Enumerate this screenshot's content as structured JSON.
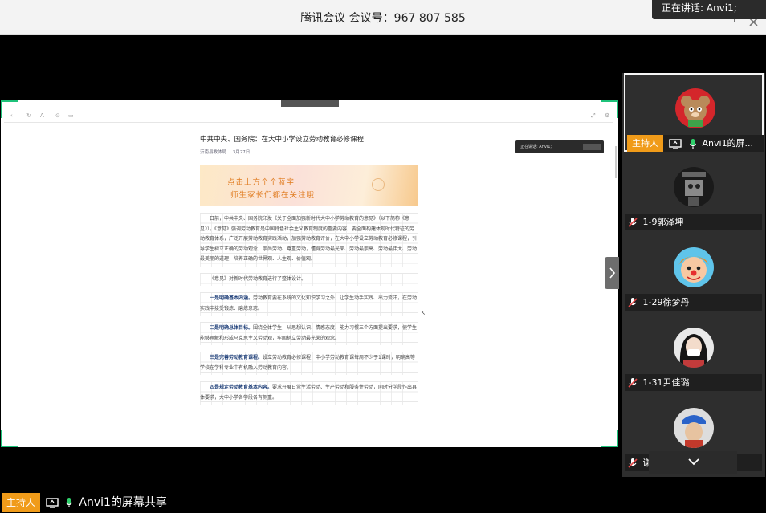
{
  "window": {
    "title": "腾讯会议 会议号：967 807 585"
  },
  "speaking": {
    "label": "正在讲话: Anvi1;"
  },
  "shared_screen": {
    "tag": "...",
    "overlay_text": "正在讲话: Anvi1;",
    "article": {
      "title": "中共中央、国务院：在大中小学设立劳动教育必修课程",
      "meta": [
        "沂南县教体局",
        "3月27日"
      ],
      "banner_line1": "点击上方个个蓝字",
      "banner_line2": "师生家长们都在关注哦",
      "p1": "日前，中共中央、国务院印发《关于全面加强新时代大中小学劳动教育的意见》（以下简称《意见》）。《意见》强调劳动教育是中国特色社会主义教育制度的重要内容，要全面构建体现时代特征的劳动教育体系，广泛开展劳动教育实践活动，加强劳动教育评价，在大中小学设立劳动教育必修课程，引导学生树立正确的劳动观念，崇尚劳动、尊重劳动，懂得劳动最光荣、劳动最崇高、劳动最伟大、劳动最美丽的道理，培养正确的世界观、人生观、价值观。",
      "p2": "《意见》对新时代劳动教育进行了整体设计。",
      "p3_bold": "一是明确基本内涵。",
      "p3": "劳动教育要在系统的文化知识学习之外，让学生动手实践、出力流汗，在劳动实践中接受锻炼、磨炼意志。",
      "p4_bold": "二是明确总体目标。",
      "p4": "围绕全体学生，从思想认识、情感态度、能力习惯三个方面提出要求，使学生能够理解和形成马克思主义劳动观，牢固树立劳动最光荣的观念。",
      "p5_bold": "三是完善劳动教育课程。",
      "p5": "设立劳动教育必修课程，中小学劳动教育课每周不少于1课时，明确高等学校在学科专业中有机融入劳动教育内容。",
      "p6_bold": "四是规定劳动教育基本内容。",
      "p6": "要求开展日常生活劳动、生产劳动和服务性劳动，同时分学段作出具体要求，大中小学各学段各有侧重。"
    }
  },
  "participants": [
    {
      "badge": "主持人",
      "name": "Anvi1的屏...",
      "avatar": "cartoon-mouse"
    },
    {
      "badge": "",
      "name": "1-9郭泽坤",
      "avatar": "dark-cartoon"
    },
    {
      "badge": "",
      "name": "1-29徐梦丹",
      "avatar": "clown"
    },
    {
      "badge": "",
      "name": "1-31尹佳璐",
      "avatar": "girl-portrait"
    },
    {
      "badge": "",
      "name": "谢勇",
      "avatar": "boy-cap"
    }
  ],
  "bottom": {
    "host_badge": "主持人",
    "share_label": "Anvi1的屏幕共享"
  },
  "colors": {
    "host_orange": "#f09b19",
    "share_border_green": "#1ec27a",
    "mic_green": "#2fd06b",
    "mute_red": "#e24646"
  }
}
